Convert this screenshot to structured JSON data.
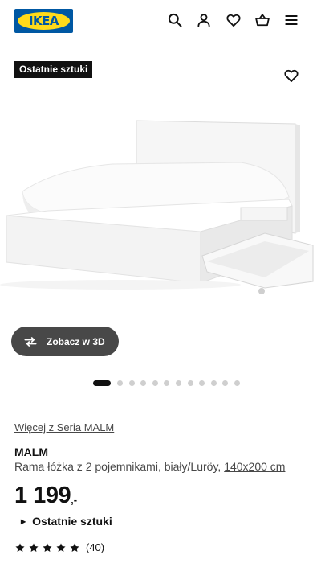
{
  "header": {
    "logo_text": "IKEA",
    "icons": [
      "search-icon",
      "user-icon",
      "heart-icon",
      "basket-icon",
      "menu-icon"
    ]
  },
  "gallery": {
    "badge": "Ostatnie sztuki",
    "view_3d_label": "Zobacz w 3D",
    "dot_count": 12,
    "active_dot": 0
  },
  "product": {
    "series_link": "Więcej z Seria MALM",
    "name": "MALM",
    "description": "Rama łóżka z 2 pojemnikami, biały/Luröy, ",
    "size_link": "140x200 cm",
    "price_main": "1 199",
    "price_suffix": ",-",
    "stock_label": "Ostatnie sztuki",
    "rating_stars": 5,
    "rating_count": "(40)"
  },
  "colors": {
    "brand_blue": "#0058a3",
    "brand_yellow": "#ffda1a",
    "badge_bg": "#111111",
    "button_3d_bg": "#484848"
  }
}
